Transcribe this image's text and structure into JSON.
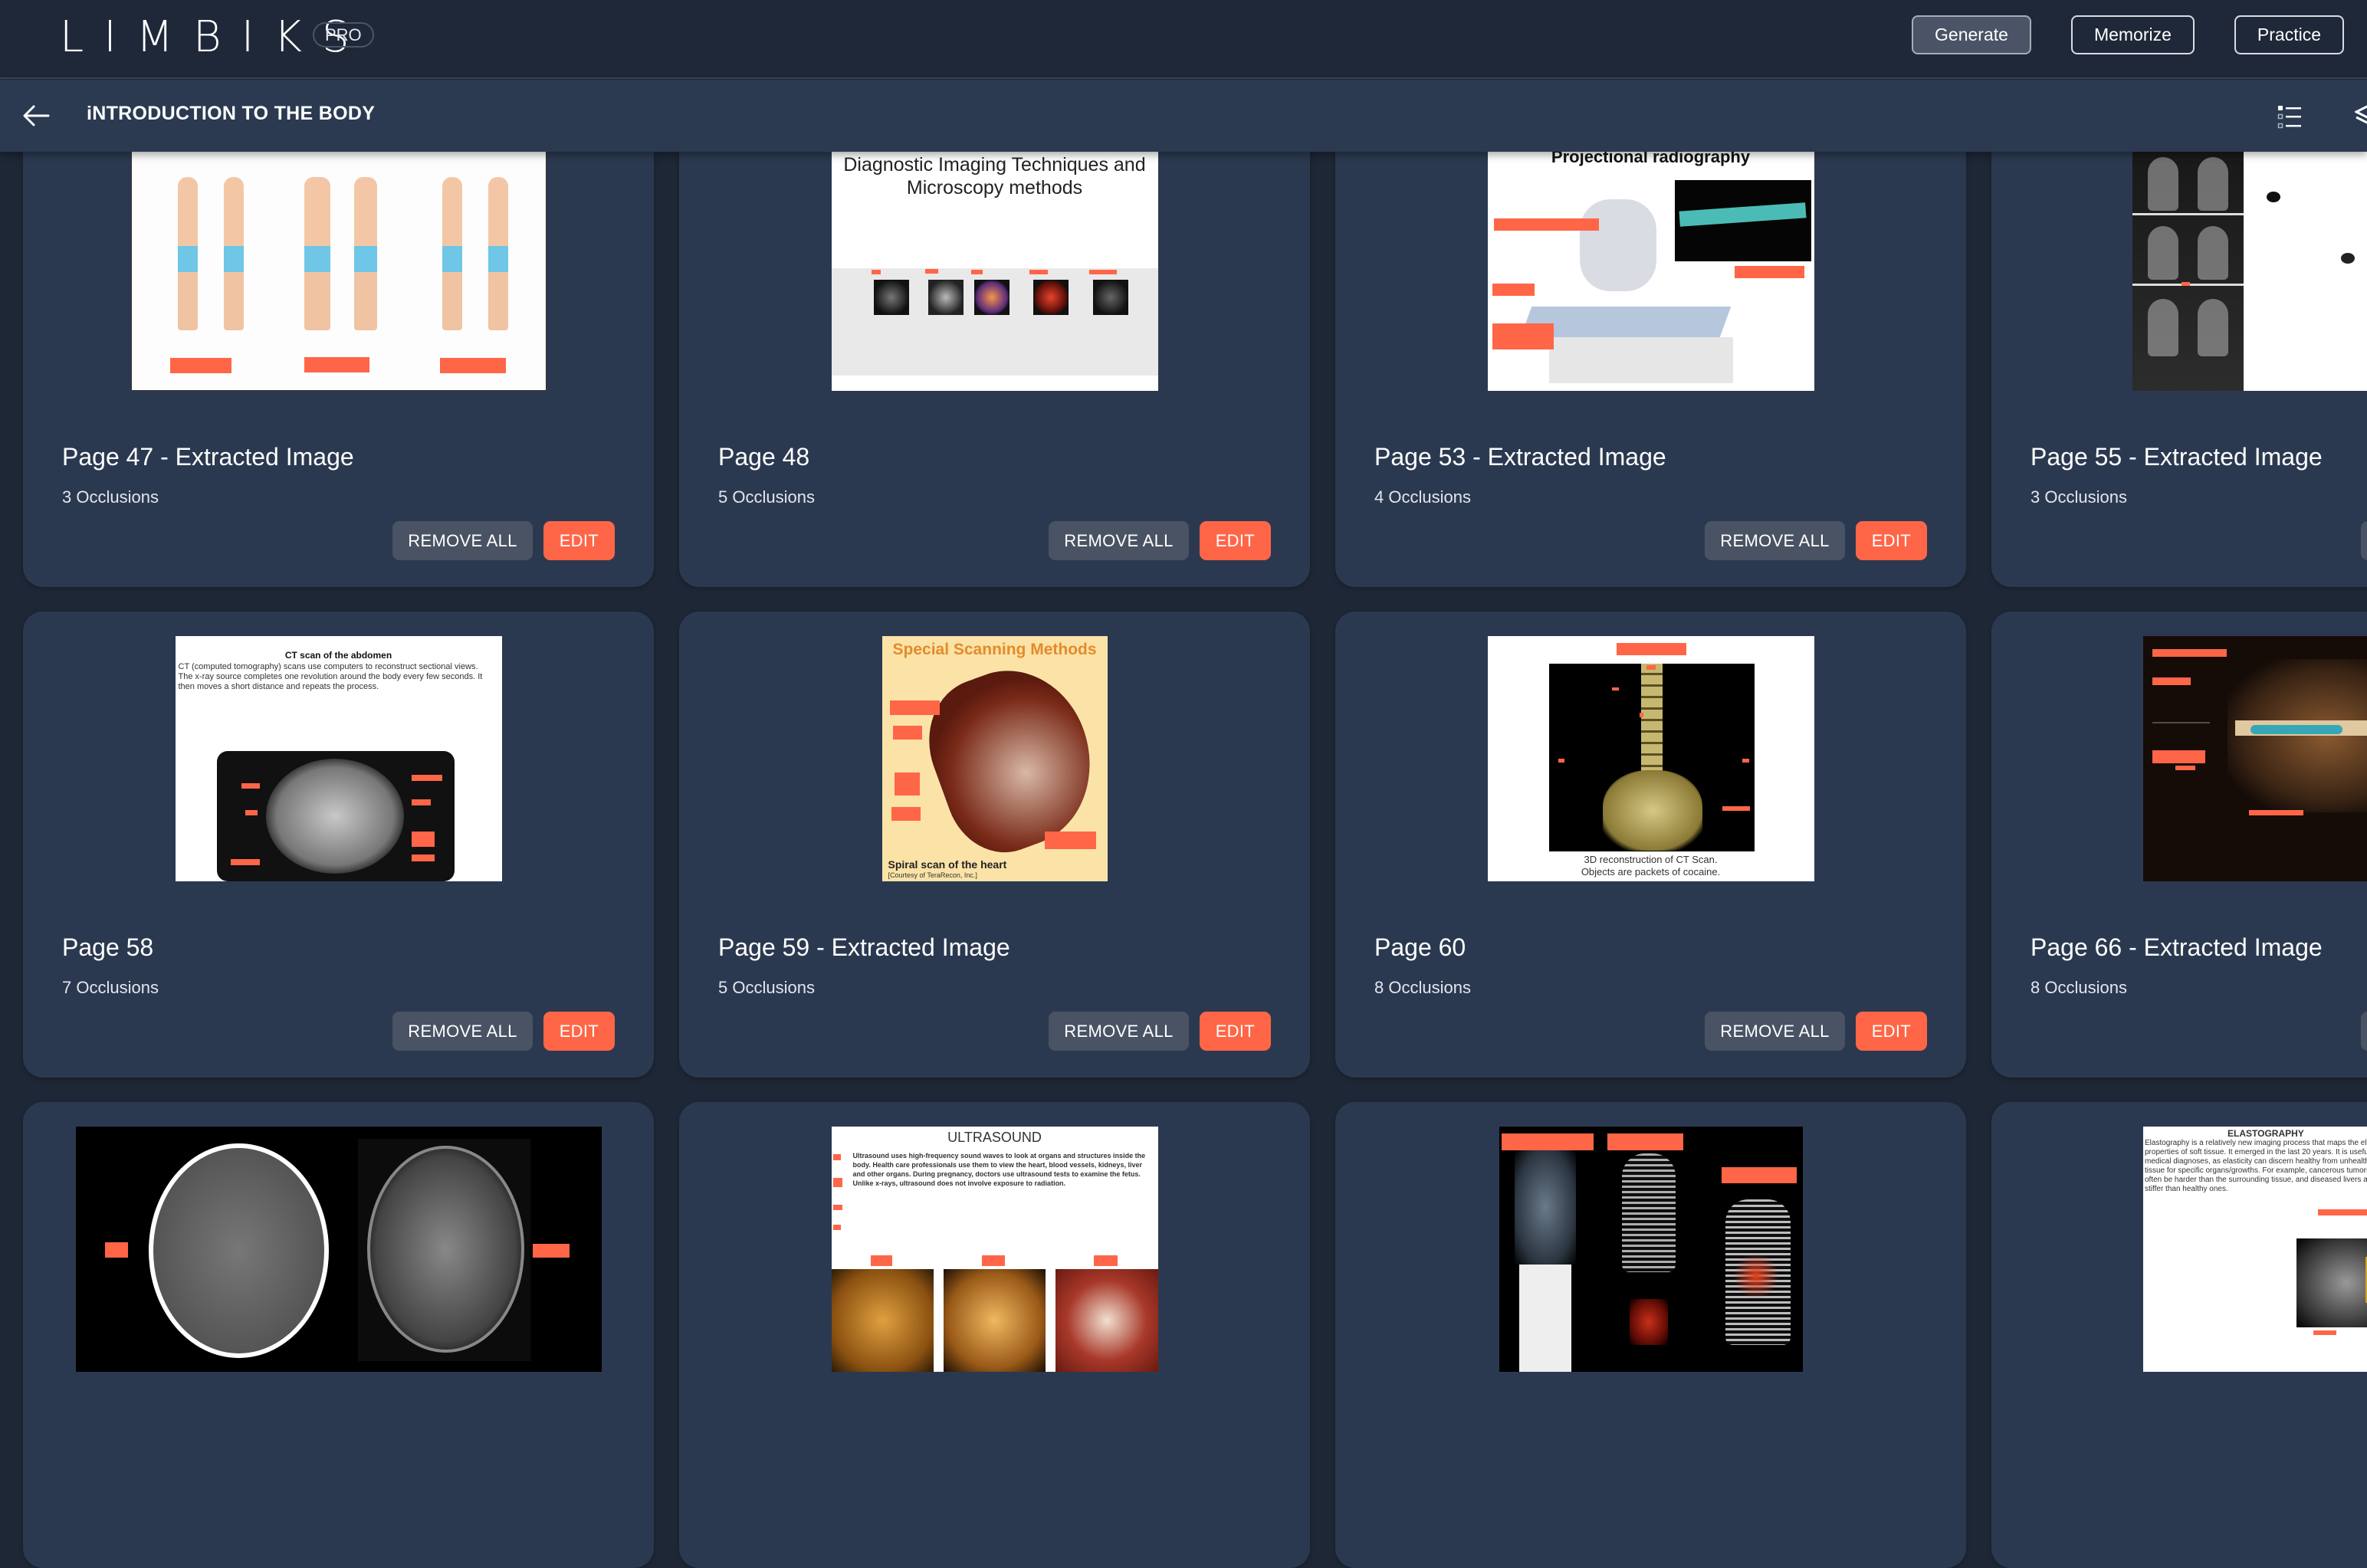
{
  "app": {
    "logo": "LIMBIKS",
    "badge": "PRO",
    "nav": [
      {
        "label": "Generate",
        "active": true
      },
      {
        "label": "Memorize",
        "active": false
      },
      {
        "label": "Practice",
        "active": false
      }
    ]
  },
  "subheader": {
    "title": "iNTRODUCTION TO THE BODY",
    "back_icon": "arrow-left-icon",
    "view_icons": [
      "list-view-icon",
      "layers-icon"
    ]
  },
  "colors": {
    "accent": "#ff6647",
    "card_bg": "#2b3950",
    "page_bg": "#1e2736",
    "secondary_button": "#4a5363"
  },
  "actions": {
    "remove_all": "REMOVE ALL",
    "edit": "EDIT"
  },
  "cards": [
    {
      "title": "Page 47 - Extracted Image",
      "occlusions": "3 Occlusions",
      "image_caption": ""
    },
    {
      "title": "Page 48",
      "occlusions": "5 Occlusions",
      "image_caption": "Diagnostic Imaging Techniques and Microscopy methods"
    },
    {
      "title": "Page 53 - Extracted Image",
      "occlusions": "4 Occlusions",
      "image_caption": "Projectional radiography"
    },
    {
      "title": "Page 55 - Extracted Image",
      "occlusions": "3 Occlusions",
      "image_caption": ""
    },
    {
      "title": "Page 58",
      "occlusions": "7 Occlusions",
      "image_caption": "CT scan of the abdomen",
      "image_text": "CT (computed tomography) scans use computers to reconstruct sectional views. The x-ray source completes one revolution around the body every few seconds. It then moves a short distance and repeats the process."
    },
    {
      "title": "Page 59 - Extracted Image",
      "occlusions": "5 Occlusions",
      "image_caption": "Special Scanning Methods",
      "image_text": "Spiral scan of the heart",
      "image_credit": "[Courtesy of TeraRecon, Inc.]"
    },
    {
      "title": "Page 60",
      "occlusions": "8 Occlusions",
      "image_caption": "3D reconstruction of CT Scan. Objects are packets of cocaine."
    },
    {
      "title": "Page 66 - Extracted Image",
      "occlusions": "8 Occlusions",
      "image_caption": ""
    },
    {
      "title": "",
      "occlusions": "",
      "image_caption": ""
    },
    {
      "title": "",
      "occlusions": "",
      "image_caption": "ULTRASOUND",
      "image_text": "Ultrasound uses high-frequency sound waves to look at organs and structures inside the body. Health care professionals use them to view the heart, blood vessels, kidneys, liver and other organs. During pregnancy, doctors use ultrasound tests to examine the fetus. Unlike x-rays, ultrasound does not involve exposure to radiation."
    },
    {
      "title": "",
      "occlusions": "",
      "image_caption": ""
    },
    {
      "title": "",
      "occlusions": "",
      "image_caption": "ELASTOGRAPHY",
      "image_text": "Elastography is a relatively new imaging process that maps the elastic properties of soft tissue. It emerged in the last 20 years. It is useful in medical diagnoses, as elasticity can discern healthy from unhealthy tissue for specific organs/growths. For example, cancerous tumors will often be harder than the surrounding tissue, and diseased livers are stiffer than healthy ones."
    }
  ]
}
